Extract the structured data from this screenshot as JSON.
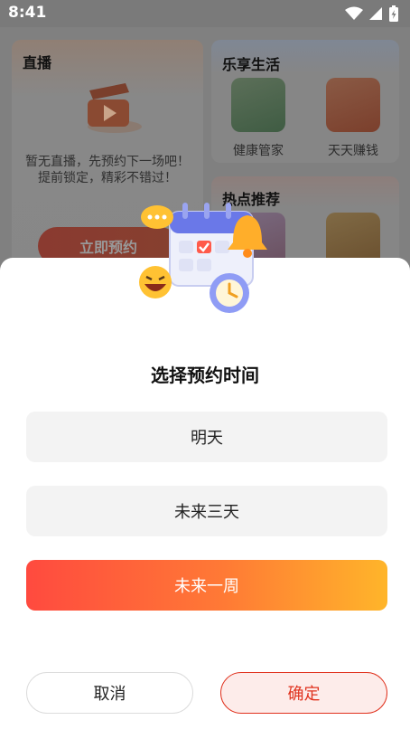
{
  "status_bar": {
    "time": "8:41",
    "icons": [
      "wifi-icon",
      "cellular-signal-icon",
      "battery-icon"
    ]
  },
  "background_page": {
    "live_card": {
      "title": "直播",
      "empty_text": "暂无直播，先预约下一场吧！提前锁定，精彩不错过！",
      "reserve_button": "立即预约"
    },
    "life_card": {
      "title": "乐享生活",
      "tiles": [
        {
          "label": "健康管家",
          "icon": "health-manager-icon"
        },
        {
          "label": "天天赚钱",
          "icon": "daily-earn-icon"
        }
      ]
    },
    "recommend_card": {
      "title": "热点推荐",
      "tiles": [
        {
          "icon": "recommend-item-icon"
        },
        {
          "icon": "trophy-icon"
        }
      ]
    }
  },
  "sheet": {
    "title": "选择预约时间",
    "options": [
      {
        "label": "明天",
        "selected": false
      },
      {
        "label": "未来三天",
        "selected": false
      },
      {
        "label": "未来一周",
        "selected": true
      }
    ],
    "cancel_label": "取消",
    "confirm_label": "确定"
  },
  "colors": {
    "accent_gradient_start": "#ff4a3f",
    "accent_gradient_end": "#ffb52a",
    "confirm_border": "#e0321e",
    "confirm_background": "#fdecea",
    "option_background": "#f3f3f3"
  }
}
